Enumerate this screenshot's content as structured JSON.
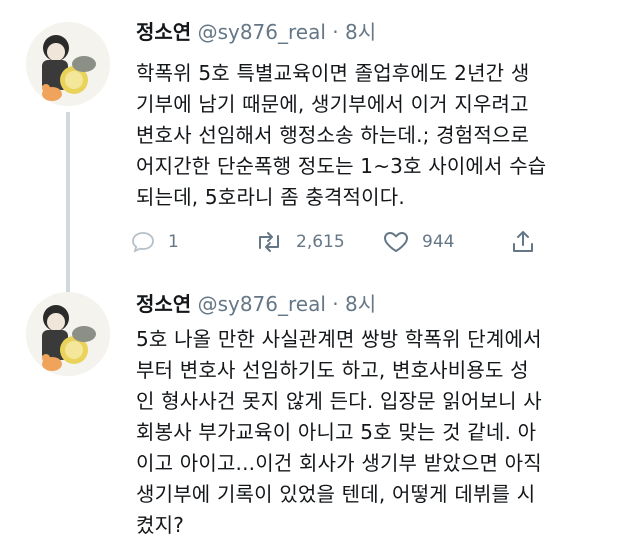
{
  "tweets": [
    {
      "name": "정소연",
      "handle": "@sy876_real",
      "separator": "·",
      "time": "8시",
      "lines": [
        "학폭위 5호 특별교육이면 졸업후에도 2년간 생",
        "기부에 남기 때문에, 생기부에서 이거 지우려고",
        "변호사 선임해서 행정소송 하는데.; 경험적으로",
        "어지간한 단순폭행 정도는 1~3호 사이에서 수습",
        "되는데, 5호라니 좀 충격적이다."
      ],
      "actions": {
        "reply_icon": "reply-icon",
        "reply_count": "1",
        "retweet_icon": "retweet-icon",
        "retweet_count": "2,615",
        "like_icon": "heart-icon",
        "like_count": "944",
        "share_icon": "share-icon"
      }
    },
    {
      "name": "정소연",
      "handle": "@sy876_real",
      "separator": "·",
      "time": "8시",
      "lines": [
        "5호 나올 만한 사실관계면 쌍방 학폭위 단계에서",
        "부터 변호사 선임하기도 하고, 변호사비용도 성",
        "인 형사사건 못지 않게 든다. 입장문 읽어보니 사",
        "회봉사 부가교육이 아니고 5호 맞는 것 같네. 아",
        "이고 아이고...이건 회사가 생기부 받았으면 아직",
        "생기부에 기록이 있었을 텐데, 어떻게 데뷔를 시",
        "켰지?"
      ]
    }
  ],
  "colors": {
    "text": "#14171a",
    "muted": "#657786",
    "thread_line": "#cfd9de"
  }
}
